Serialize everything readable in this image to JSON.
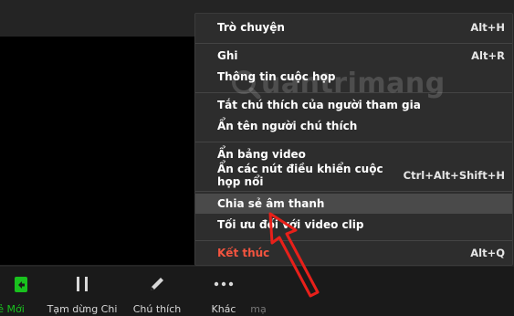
{
  "menu": {
    "items": [
      {
        "label": "Trò chuyện",
        "shortcut": "Alt+H"
      },
      {
        "label": "Ghi",
        "shortcut": "Alt+R"
      },
      {
        "label": "Thông tin cuộc họp",
        "shortcut": ""
      },
      {
        "label": "Tắt chú thích của người tham gia",
        "shortcut": ""
      },
      {
        "label": "Ẩn tên người chú thích",
        "shortcut": ""
      },
      {
        "label": "Ẩn bảng video",
        "shortcut": ""
      },
      {
        "label": "Ẩn các nút điều khiển cuộc họp nổi",
        "shortcut": "Ctrl+Alt+Shift+H"
      },
      {
        "label": "Chia sẻ âm thanh",
        "shortcut": ""
      },
      {
        "label": "Tối ưu đối với video clip",
        "shortcut": ""
      },
      {
        "label": "Kết thúc",
        "shortcut": "Alt+Q"
      }
    ],
    "highlighted_item": "Chia sẻ âm thanh",
    "end_color": "#f3543f"
  },
  "toolbar": {
    "share_label": "ẻ Mới",
    "pause_label": "Tạm dừng Chi",
    "annotate_label": "Chú thích",
    "more_label": "Khác",
    "partial_label": "mạ",
    "accent": "#19c11e"
  },
  "watermark": {
    "text": "uantrimang",
    "icon": "magnifier-q-icon"
  },
  "annotation": {
    "icon": "red-arrow-icon",
    "color": "#e8201a"
  }
}
